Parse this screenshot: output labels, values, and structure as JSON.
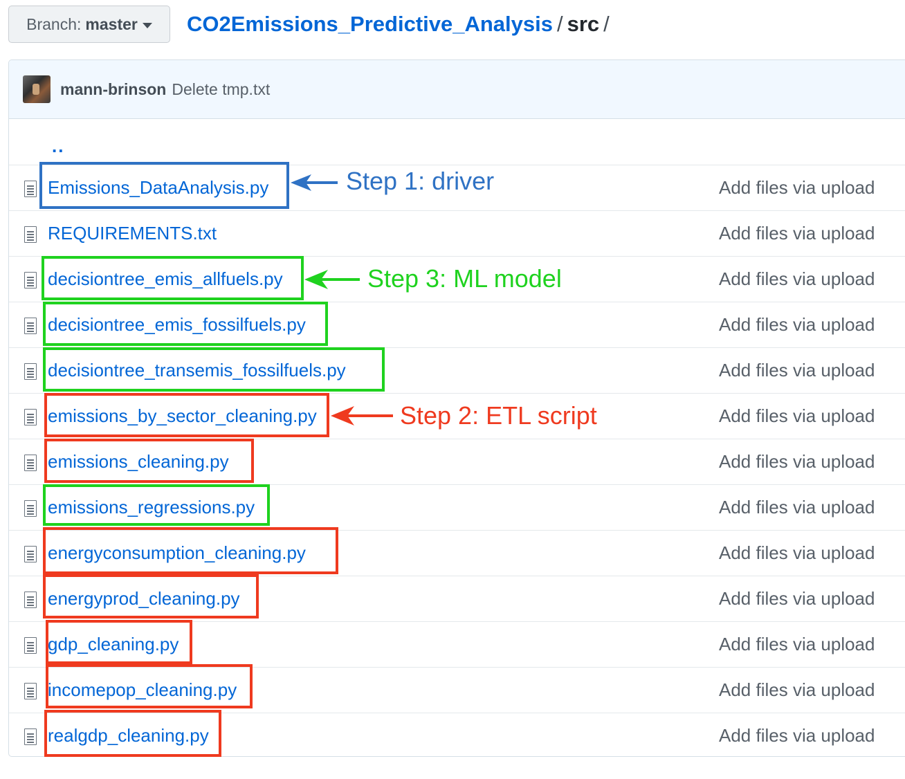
{
  "branch": {
    "prefix": "Branch:",
    "name": "master"
  },
  "breadcrumb": {
    "repo": "CO2Emissions_Predictive_Analysis",
    "sep1": "/",
    "folder": "src",
    "sep2": "/"
  },
  "commit": {
    "user": "mann-brinson",
    "message": "Delete tmp.txt"
  },
  "parent_link": "..",
  "files": [
    {
      "name": "Emissions_DataAnalysis.py",
      "message": "Add files via upload"
    },
    {
      "name": "REQUIREMENTS.txt",
      "message": "Add files via upload"
    },
    {
      "name": "decisiontree_emis_allfuels.py",
      "message": "Add files via upload"
    },
    {
      "name": "decisiontree_emis_fossilfuels.py",
      "message": "Add files via upload"
    },
    {
      "name": "decisiontree_transemis_fossilfuels.py",
      "message": "Add files via upload"
    },
    {
      "name": "emissions_by_sector_cleaning.py",
      "message": "Add files via upload"
    },
    {
      "name": "emissions_cleaning.py",
      "message": "Add files via upload"
    },
    {
      "name": "emissions_regressions.py",
      "message": "Add files via upload"
    },
    {
      "name": "energyconsumption_cleaning.py",
      "message": "Add files via upload"
    },
    {
      "name": "energyprod_cleaning.py",
      "message": "Add files via upload"
    },
    {
      "name": "gdp_cleaning.py",
      "message": "Add files via upload"
    },
    {
      "name": "incomepop_cleaning.py",
      "message": "Add files via upload"
    },
    {
      "name": "realgdp_cleaning.py",
      "message": "Add files via upload"
    }
  ],
  "annotations": {
    "step1": "Step 1: driver",
    "step2": "Step 2: ETL script",
    "step3": "Step 3: ML model"
  },
  "colors": {
    "blue": "#2f72c4",
    "green": "#1fd21f",
    "red": "#ef3a1f",
    "link": "#0366d6"
  }
}
